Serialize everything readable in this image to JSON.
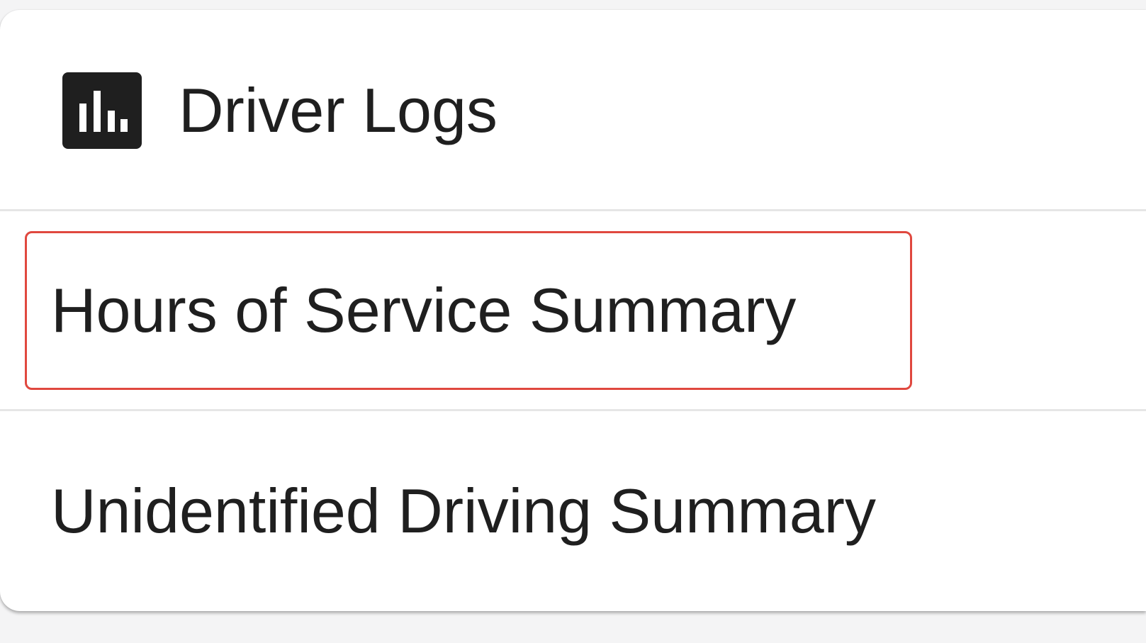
{
  "card": {
    "title": "Driver Logs",
    "icon": "bar-chart-icon",
    "icon_bg": "#1f1f1f"
  },
  "menu": {
    "items": [
      {
        "label": "Hours of Service Summary",
        "highlighted": true
      },
      {
        "label": "Unidentified Driving Summary",
        "highlighted": false
      }
    ]
  },
  "colors": {
    "text": "#1f1f1f",
    "divider": "#e6e6e6",
    "highlight": "#e0483f",
    "card_bg": "#ffffff"
  }
}
